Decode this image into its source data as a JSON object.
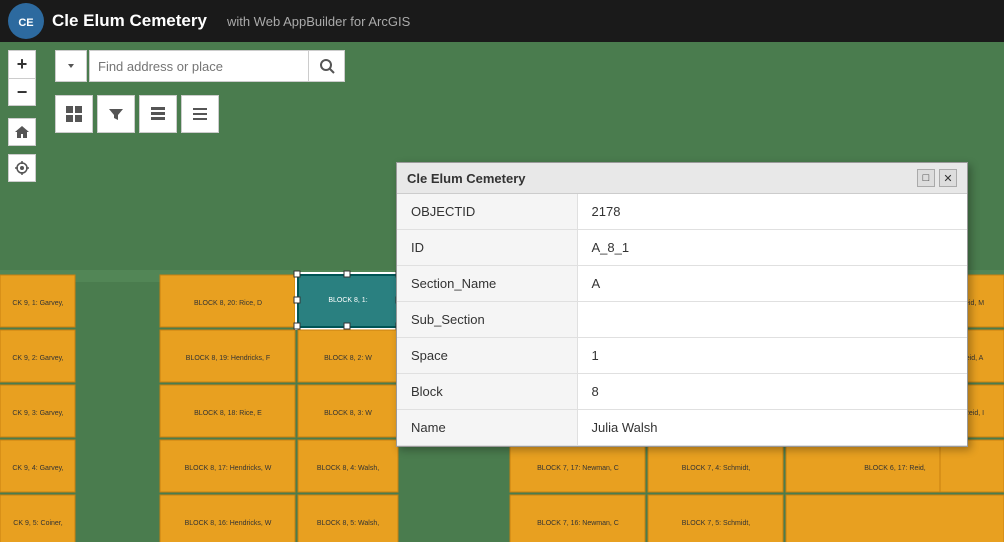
{
  "app": {
    "title": "Cle Elum Cemetery",
    "subtitle": "with Web AppBuilder for ArcGIS",
    "logo_text": "CE"
  },
  "search": {
    "placeholder": "Find address or place",
    "input_value": ""
  },
  "zoom": {
    "plus_label": "+",
    "minus_label": "−"
  },
  "toolbar": {
    "grid_icon": "⊞",
    "filter_icon": "▼",
    "table_icon": "⊟",
    "list_icon": "≡"
  },
  "nav_buttons": {
    "home_label": "⌂",
    "locate_label": "◎"
  },
  "popup": {
    "title": "Cle Elum Cemetery",
    "maximize_label": "□",
    "close_label": "✕",
    "fields": [
      {
        "label": "OBJECTID",
        "value": "2178"
      },
      {
        "label": "ID",
        "value": "A_8_1"
      },
      {
        "label": "Section_Name",
        "value": "A"
      },
      {
        "label": "Sub_Section",
        "value": ""
      },
      {
        "label": "Space",
        "value": "1"
      },
      {
        "label": "Block",
        "value": "8"
      },
      {
        "label": "Name",
        "value": "Julia Walsh"
      }
    ]
  },
  "plots": {
    "rows": [
      [
        {
          "label": "BLOCK 8, 20: Rice, D",
          "highlight": false
        },
        {
          "label": "BLOCK 8, 1:",
          "highlight": true
        }
      ],
      [
        {
          "label": "BLOCK 8, 19: Hendricks, F",
          "highlight": false
        },
        {
          "label": "BLOCK 8, 2: W",
          "highlight": false
        }
      ],
      [
        {
          "label": "BLOCK 8, 18: Rice, E",
          "highlight": false
        },
        {
          "label": "BLOCK 8, 3: W",
          "highlight": false
        }
      ],
      [
        {
          "label": "BLOCK 8, 17: Hendricks, W",
          "highlight": false
        },
        {
          "label": "BLOCK 8, 4: Walsh,",
          "highlight": false
        }
      ],
      [
        {
          "label": "BLOCK 8, 16: Hendricks, W",
          "highlight": false
        },
        {
          "label": "BLOCK 8, 5: Walsh,",
          "highlight": false
        }
      ]
    ],
    "left_column": [
      "CK 9, 1: Garvey,",
      "CK 9, 2: Garvey,",
      "CK 9, 3: Garvey,",
      "CK 9, 4: Garvey,",
      "CK 9, 5: Coiner,"
    ],
    "right_column": [
      "Reid, M",
      "Reid, A",
      ", Reid, I",
      "",
      ""
    ],
    "bottom_rows": [
      {
        "label": "BLOCK 7, 17: Newman, C"
      },
      {
        "label": "BLOCK 7, 4: Schmidt,"
      },
      {
        "label": "BLOCK 7, 16: Newman, C"
      },
      {
        "label": "BLOCK 7, 5: Schmidt,"
      },
      {
        "label": "BLOCK 6, 17: Reid,"
      }
    ]
  }
}
